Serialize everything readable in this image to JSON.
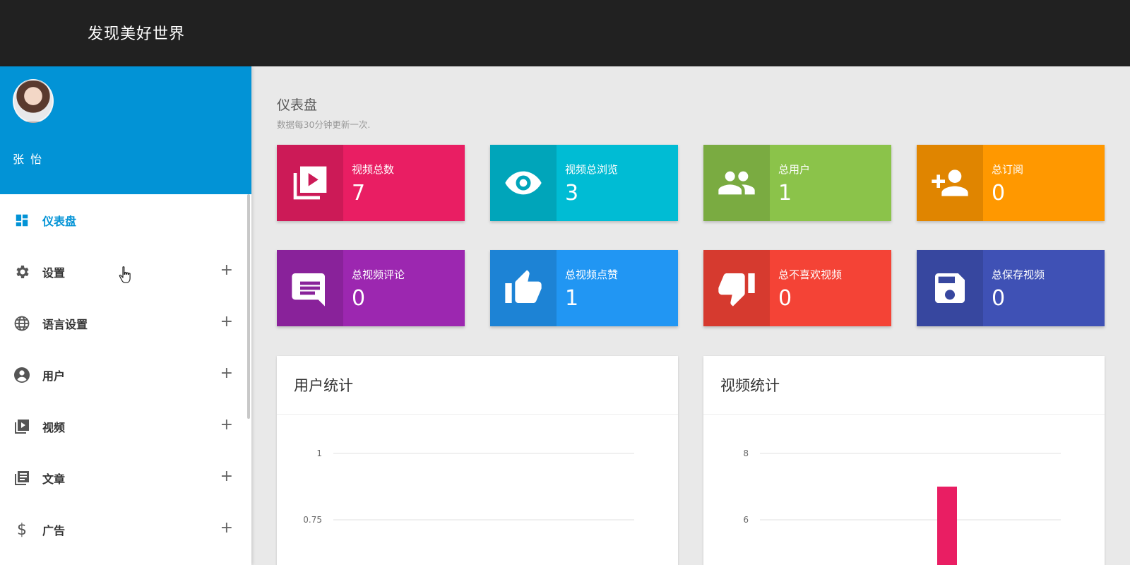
{
  "header": {
    "brand": "发现美好世界"
  },
  "sidebar": {
    "user_name": "张 怡",
    "items": [
      {
        "label": "仪表盘",
        "icon": "dashboard-icon",
        "active": true
      },
      {
        "label": "设置",
        "icon": "gear-icon",
        "expand": "+"
      },
      {
        "label": "语言设置",
        "icon": "globe-icon",
        "expand": "+"
      },
      {
        "label": "用户",
        "icon": "user-circle-icon",
        "expand": "+"
      },
      {
        "label": "视频",
        "icon": "video-icon",
        "expand": "+"
      },
      {
        "label": "文章",
        "icon": "article-icon",
        "expand": "+"
      },
      {
        "label": "广告",
        "icon": "dollar-icon",
        "expand": "+"
      }
    ]
  },
  "main": {
    "title": "仪表盘",
    "subtitle": "数据每30分钟更新一次.",
    "stats": [
      {
        "label": "视频总数",
        "value": "7",
        "color": "#e91e63",
        "icon": "video-library-icon"
      },
      {
        "label": "视频总浏览",
        "value": "3",
        "color": "#00bcd4",
        "icon": "eye-icon"
      },
      {
        "label": "总用户",
        "value": "1",
        "color": "#8bc34a",
        "icon": "people-icon"
      },
      {
        "label": "总订阅",
        "value": "0",
        "color": "#ff9800",
        "icon": "person-add-icon"
      },
      {
        "label": "总视频评论",
        "value": "0",
        "color": "#9c27b0",
        "icon": "comment-icon"
      },
      {
        "label": "总视频点赞",
        "value": "1",
        "color": "#2196f3",
        "icon": "thumb-up-icon"
      },
      {
        "label": "总不喜欢视频",
        "value": "0",
        "color": "#f44336",
        "icon": "thumb-down-icon"
      },
      {
        "label": "总保存视频",
        "value": "0",
        "color": "#3f51b5",
        "icon": "save-icon"
      }
    ]
  },
  "chart_data": [
    {
      "type": "line",
      "title": "用户统计",
      "y_ticks": [
        "1",
        "0.75"
      ],
      "grid": true
    },
    {
      "type": "bar",
      "title": "视频统计",
      "y_ticks": [
        "8",
        "6"
      ],
      "values": [
        7
      ],
      "bar_color": "#e91e63",
      "grid": true
    }
  ]
}
